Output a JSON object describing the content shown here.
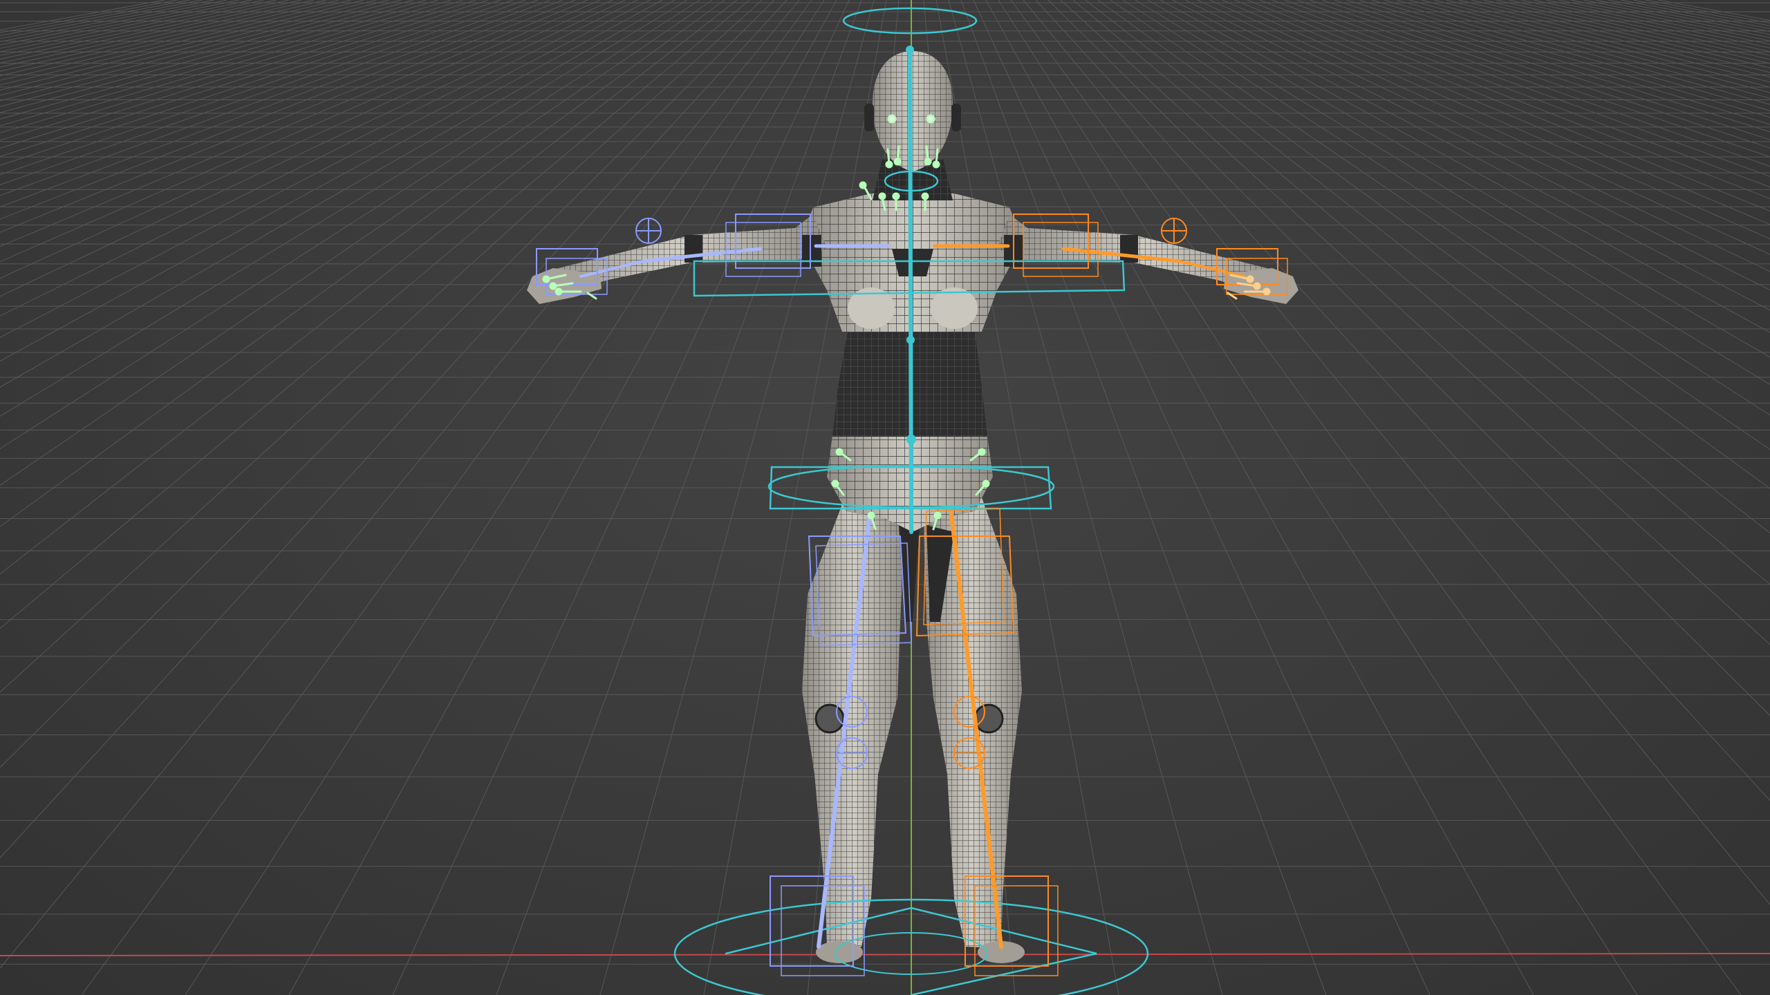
{
  "viewport": {
    "background": "#3b3b3b",
    "grid_color": "#575757",
    "axis_x_color": "#c7474b",
    "axis_y_color": "#7bb33c"
  },
  "rig": {
    "center_color": "#3cc7d1",
    "left_color": "#a9b7ff",
    "right_color": "#ff9b2b",
    "facial_control_color": "#b6ffb9",
    "mesh_fill": "#bdbab1",
    "mesh_dark": "#2f2f2f",
    "wire_color": "#3a3a3a"
  },
  "icons": {
    "root_control": "root-control-icon",
    "ik_target": "ik-target-icon",
    "pole_target": "pole-target-icon"
  }
}
